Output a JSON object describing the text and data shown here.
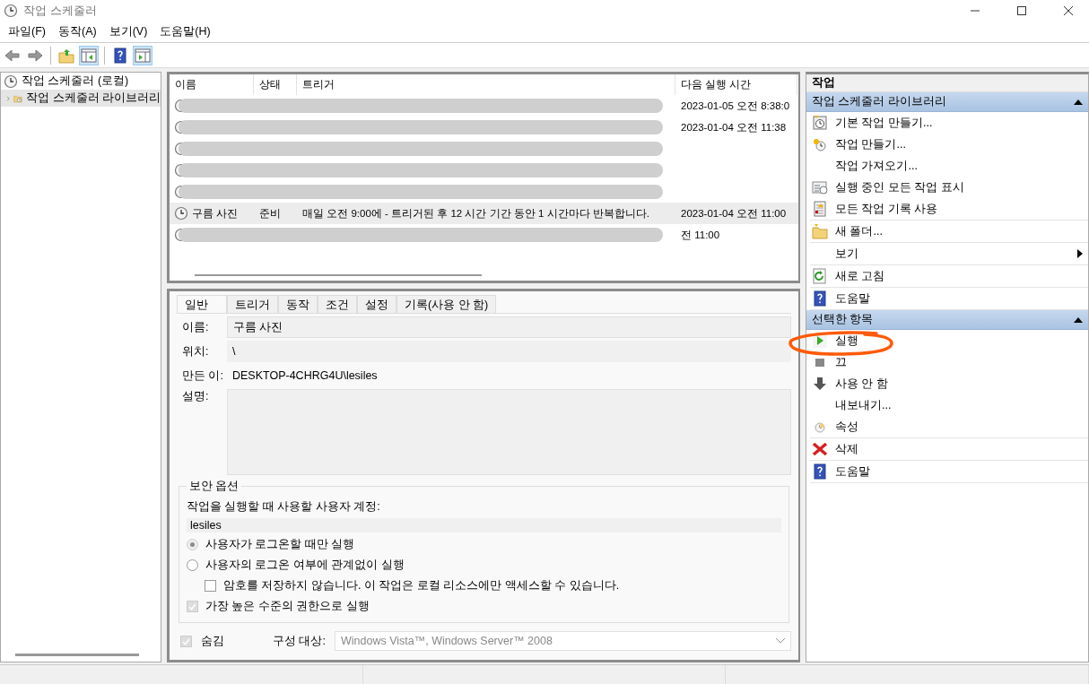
{
  "window": {
    "title": "작업 스케줄러"
  },
  "menu": [
    "파일(F)",
    "동작(A)",
    "보기(V)",
    "도움말(H)"
  ],
  "tree": [
    {
      "label": "작업 스케줄러 (로컬)",
      "selected": false,
      "children": [
        {
          "label": "작업 스케줄러 라이브러리",
          "selected": true,
          "expanded": false
        }
      ]
    }
  ],
  "task_list": {
    "columns": [
      "이름",
      "상태",
      "트리거",
      "다음 실행 시간"
    ],
    "rows": [
      {
        "redacted": true,
        "selected": false,
        "next_run": "2023-01-05 오전 8:38:0"
      },
      {
        "redacted": true,
        "selected": false,
        "next_run": "2023-01-04 오전 11:38"
      },
      {
        "redacted": true,
        "selected": false
      },
      {
        "redacted": true,
        "selected": false
      },
      {
        "redacted": true,
        "selected": false
      },
      {
        "redacted": false,
        "selected": true,
        "name": "구름 사진",
        "status": "준비",
        "trigger": "매일 오전 9:00에 - 트리거된 후 12 시간 기간 동안 1 시간마다 반복합니다.",
        "next_run": "2023-01-04 오전 11:00"
      },
      {
        "redacted": true,
        "selected": false,
        "next_run": "전 11:00"
      }
    ]
  },
  "details": {
    "tabs": [
      {
        "label": "일반",
        "selected": true
      },
      {
        "label": "트리거",
        "selected": false
      },
      {
        "label": "동작",
        "selected": false
      },
      {
        "label": "조건",
        "selected": false
      },
      {
        "label": "설정",
        "selected": false
      },
      {
        "label": "기록(사용 안 함)",
        "selected": false
      }
    ],
    "name_label": "이름:",
    "name": "구름 사진",
    "location_label": "위치:",
    "location": "\\",
    "author_label": "만든 이:",
    "author": "DESKTOP-4CHRG4U\\lesiles",
    "description_label": "설명:",
    "security": {
      "title": "보안 옵션",
      "account_label": "작업을 실행할 때 사용할 사용자 계정:",
      "account": "lesiles",
      "options": [
        {
          "kind": "radio",
          "label": "사용자가 로그온할 때만 실행",
          "selected": true,
          "disabled": true
        },
        {
          "kind": "radio",
          "label": "사용자의 로그온 여부에 관계없이 실행",
          "selected": false,
          "disabled": false
        },
        {
          "kind": "checkbox",
          "label": "암호를 저장하지 않습니다. 이 작업은 로컬 리소스에만 액세스할 수 있습니다.",
          "checked": false,
          "disabled": false,
          "indented": true
        },
        {
          "kind": "checkbox",
          "label": "가장 높은 수준의 권한으로 실행",
          "checked": true,
          "disabled": true,
          "indented": false
        }
      ]
    },
    "hidden": {
      "label": "숨김",
      "checked": true,
      "disabled": true
    },
    "configure_label": "구성 대상:",
    "configure_value": "Windows Vista™, Windows Server™ 2008"
  },
  "actions": {
    "title": "작업",
    "sections": [
      {
        "title": "작업 스케줄러 라이브러리",
        "expanded": true,
        "groups": [
          [
            {
              "kind": "basic-task",
              "label": "기본 작업 만들기..."
            },
            {
              "kind": "create-task",
              "label": "작업 만들기..."
            },
            {
              "kind": "none",
              "label": "작업 가져오기..."
            },
            {
              "kind": "running",
              "label": "실행 중인 모든 작업 표시"
            },
            {
              "kind": "history",
              "label": "모든 작업 기록 사용"
            }
          ],
          [
            {
              "kind": "folder",
              "label": "새 폴더..."
            }
          ],
          [
            {
              "kind": "none",
              "label": "보기",
              "submenu": true
            }
          ],
          [
            {
              "kind": "refresh",
              "label": "새로 고침"
            }
          ],
          [
            {
              "kind": "help",
              "label": "도움말"
            }
          ]
        ]
      },
      {
        "title": "선택한 항목",
        "expanded": true,
        "groups": [
          [
            {
              "kind": "run",
              "label": "실행"
            },
            {
              "kind": "end",
              "label": "끄"
            },
            {
              "kind": "disable",
              "label": "사용 안 함"
            },
            {
              "kind": "none",
              "label": "내보내기..."
            },
            {
              "kind": "properties",
              "label": "속성"
            }
          ],
          [
            {
              "kind": "delete",
              "label": "삭제"
            }
          ],
          [
            {
              "kind": "help",
              "label": "도움말"
            }
          ]
        ]
      }
    ]
  }
}
